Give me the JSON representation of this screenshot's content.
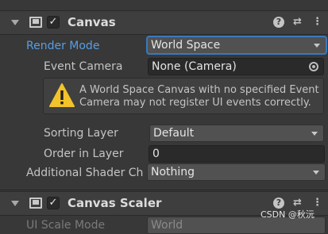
{
  "canvas": {
    "title": "Canvas",
    "enabled_mark": "✓",
    "render_mode": {
      "label": "Render Mode",
      "value": "World Space"
    },
    "event_camera": {
      "label": "Event Camera",
      "value": "None (Camera)"
    },
    "warning": "A World Space Canvas with no specified Event Camera may not register UI events correctly.",
    "sorting_layer": {
      "label": "Sorting Layer",
      "value": "Default"
    },
    "order_in_layer": {
      "label": "Order in Layer",
      "value": "0"
    },
    "shader_channels": {
      "label": "Additional Shader Ch",
      "value": "Nothing"
    }
  },
  "canvas_scaler": {
    "title": "Canvas Scaler",
    "enabled_mark": "✓",
    "ui_scale_mode": {
      "label": "UI Scale Mode",
      "value": "World"
    }
  },
  "header_icons": {
    "help": "?",
    "presets": "⇄",
    "more": "⋮"
  },
  "watermark": "CSDN @秋沅",
  "colors": {
    "background": "#383838",
    "header": "#3e3e3e",
    "highlight_label": "#589ee4",
    "field_bg": "#2a2a2a",
    "dropdown_bg": "#515151",
    "warning_yellow": "#f2c32a"
  }
}
